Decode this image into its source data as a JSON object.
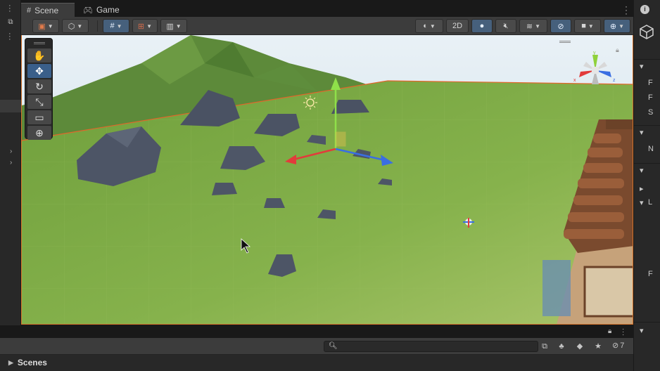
{
  "tabs": [
    {
      "label": "Scene",
      "icon": "grid-icon",
      "active": true
    },
    {
      "label": "Game",
      "icon": "gamepad-icon",
      "active": false
    }
  ],
  "toolbar": {
    "draw_mode_icon": "draw-mode-icon",
    "shading_icon": "cube-icon",
    "grid_snap_icon": "grid-snap-icon",
    "increment_snap_icon": "increment-snap-icon",
    "render_icon": "render-paths-icon",
    "two_d_label": "2D",
    "lighting_icon": "lightbulb-icon",
    "audio_icon": "audio-icon",
    "effects_icon": "effects-layers-icon",
    "visibility_icon": "eye-slash-icon",
    "camera_icon": "camera-icon",
    "gizmos_icon": "gizmos-globe-icon"
  },
  "tools": [
    {
      "name": "view-tool",
      "glyph": "✋",
      "active": false
    },
    {
      "name": "move-tool",
      "glyph": "✥",
      "active": true
    },
    {
      "name": "rotate-tool",
      "glyph": "↻",
      "active": false
    },
    {
      "name": "scale-tool",
      "glyph": "⤡",
      "active": false
    },
    {
      "name": "rect-tool",
      "glyph": "▭",
      "active": false
    },
    {
      "name": "transform-tool",
      "glyph": "⊕",
      "active": false
    }
  ],
  "gizmo": {
    "y_label": "y",
    "x_label": "x",
    "z_label": "z",
    "colors": {
      "x": "#e23b3b",
      "y": "#8fd13a",
      "z": "#3a6ee2"
    }
  },
  "inspector_strip": {
    "rows": [
      "F",
      "F",
      "S",
      "N",
      "L",
      "F"
    ]
  },
  "bottom_panel": {
    "search_value": "",
    "hidden_count": "7",
    "scenes_label": "Scenes"
  },
  "colors": {
    "accent_blue": "#3a5f8a",
    "viewport_border": "#d4722a",
    "ground": "#7aa844",
    "sky": "#cfe0ea"
  }
}
